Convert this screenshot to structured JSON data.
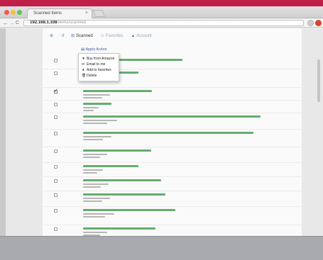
{
  "theme": {
    "accent_green": "#55a35e",
    "link_blue": "#3b5f9c",
    "banner_red": "#bf2048"
  },
  "browser": {
    "tab_title": "Scanned Items",
    "tab_close": "×",
    "url_page_icon": "▫",
    "url_host": "192.168.1.108",
    "url_path": "/items/scanned",
    "back_glyph": "←",
    "forward_glyph": "→",
    "reload_glyph": "C"
  },
  "nav": {
    "scanned_label": "Scanned",
    "favorites_label": "Favorites",
    "account_label": "Account",
    "scanned_icon_glyph": "⊞",
    "favorites_icon_glyph": "☆",
    "account_icon_glyph": "▲",
    "home_icon_glyph": "⊕",
    "refresh_icon_glyph": "↺"
  },
  "actions": {
    "apply_action_label": "Apply Action",
    "apply_action_icon": "▤",
    "menu": [
      {
        "icon": "▼",
        "label": "Buy from Amazon"
      },
      {
        "icon": "✉",
        "label": "Email to me"
      },
      {
        "icon": "★",
        "label": "Add to favorites"
      },
      {
        "icon": "🗑",
        "label": "Delete"
      }
    ]
  },
  "items": [
    {
      "checked": false
    },
    {
      "checked": false
    },
    {
      "checked": true
    },
    {
      "checked": false
    },
    {
      "checked": false
    },
    {
      "checked": false
    },
    {
      "checked": false
    },
    {
      "checked": false
    },
    {
      "checked": false
    },
    {
      "checked": false
    },
    {
      "checked": false
    },
    {
      "checked": false
    }
  ]
}
